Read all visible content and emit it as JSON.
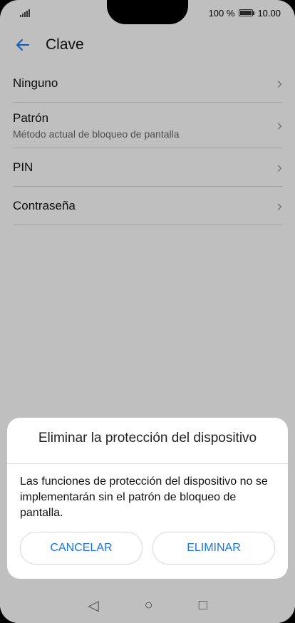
{
  "status": {
    "battery": "100 %",
    "time": "10.00",
    "battery_level": 1.0
  },
  "header": {
    "title": "Clave"
  },
  "items": [
    {
      "label": "Ninguno",
      "sub": ""
    },
    {
      "label": "Patrón",
      "sub": "Método actual de bloqueo de pantalla"
    },
    {
      "label": "PIN",
      "sub": ""
    },
    {
      "label": "Contraseña",
      "sub": ""
    }
  ],
  "dialog": {
    "title": "Eliminar la protección del dispositivo",
    "message": "Las funciones de protección del dispositivo no se implementarán sin el patrón de bloqueo de pantalla.",
    "cancel": "CANCELAR",
    "confirm": "ELIMINAR"
  },
  "colors": {
    "accent": "#1a73e8",
    "background": "#f5f5f5"
  }
}
